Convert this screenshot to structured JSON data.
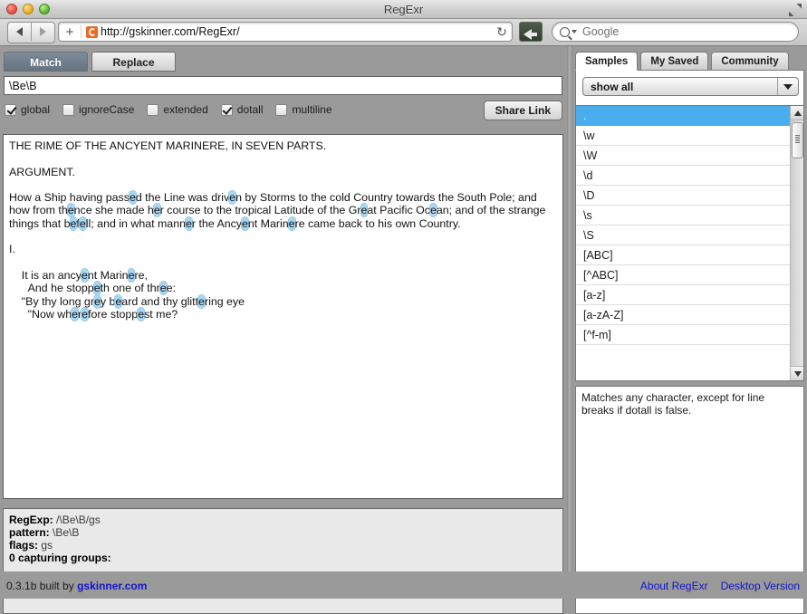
{
  "window": {
    "title": "RegExr",
    "fullscreen_icon": "fullscreen-expand-icon",
    "traffic_lights": [
      "close",
      "minimize",
      "zoom"
    ]
  },
  "browser": {
    "back_icon": "back-arrow-icon",
    "forward_icon": "forward-arrow-icon",
    "new_tab_label": "+",
    "favicon": "regexr-favicon",
    "url": "http://gskinner.com/RegExr/",
    "reload_icon": "reload-icon",
    "reader_icon": "reader-view-icon",
    "search_icon": "search-magnifier-icon",
    "search_placeholder": "Google",
    "search_value": ""
  },
  "editor": {
    "tabs": [
      {
        "label": "Match",
        "active": true
      },
      {
        "label": "Replace",
        "active": false
      }
    ],
    "pattern": "\\Be\\B",
    "flags": [
      {
        "label": "global",
        "checked": true
      },
      {
        "label": "ignoreCase",
        "checked": false
      },
      {
        "label": "extended",
        "checked": false
      },
      {
        "label": "dotall",
        "checked": true
      },
      {
        "label": "multiline",
        "checked": false
      }
    ],
    "share_label": "Share Link",
    "source_lines": [
      "THE RIME OF THE ANCYENT MARINERE, IN SEVEN PARTS.",
      "",
      "ARGUMENT.",
      "",
      "How a Ship having pass[e]d the Line was driv[e]n by Storms to the cold Country towards the South Pole; and how from th[e]nce she made h[e]r course to the tropical Latitude of the Gr[e]at Pacific Oc[e]an; and of the strange things that b[e]f[e]ll; and in what mann[e]r the Ancy[e]nt Marin[e]re came back to his own Country.",
      "",
      "I.",
      "",
      "    It is an ancy[e]nt Marin[e]re,",
      "      And he stopp[e]th one of thr[e]e:",
      "    \"By thy long gr[e]y b[e]ard and thy glitt[e]ring eye",
      "      \"Now wh[e]r[e]fore stopp[e]st me?"
    ]
  },
  "results": {
    "regexp_label": "RegExp:",
    "regexp_value": "/\\Be\\B/gs",
    "pattern_label": "pattern:",
    "pattern_value": "\\Be\\B",
    "flags_label": "flags:",
    "flags_value": "gs",
    "groups_label": "0 capturing groups:"
  },
  "sidebar": {
    "tabs": [
      {
        "label": "Samples",
        "active": true
      },
      {
        "label": "My Saved",
        "active": false
      },
      {
        "label": "Community",
        "active": false
      }
    ],
    "filter_value": "show all",
    "filter_caret_icon": "chevron-down-icon",
    "scroll_up_icon": "scroll-up-arrow-icon",
    "scroll_down_icon": "scroll-down-arrow-icon",
    "items": [
      {
        "label": ".",
        "selected": true
      },
      {
        "label": "\\w",
        "selected": false
      },
      {
        "label": "\\W",
        "selected": false
      },
      {
        "label": "\\d",
        "selected": false
      },
      {
        "label": "\\D",
        "selected": false
      },
      {
        "label": "\\s",
        "selected": false
      },
      {
        "label": "\\S",
        "selected": false
      },
      {
        "label": "[ABC]",
        "selected": false
      },
      {
        "label": "[^ABC]",
        "selected": false
      },
      {
        "label": "[a-z]",
        "selected": false
      },
      {
        "label": "[a-zA-Z]",
        "selected": false
      },
      {
        "label": "[^f-m]",
        "selected": false
      }
    ],
    "description": "Matches any character, except for line breaks if dotall is false."
  },
  "footer": {
    "version_prefix": "0.3.1b built by ",
    "version_link": "gskinner.com",
    "links": [
      "About RegExr",
      "Desktop Version"
    ]
  },
  "colors": {
    "highlight": "#a9d6f2",
    "selection": "#4aaded",
    "link": "#1414c8",
    "chrome": "#9a9a9a"
  }
}
